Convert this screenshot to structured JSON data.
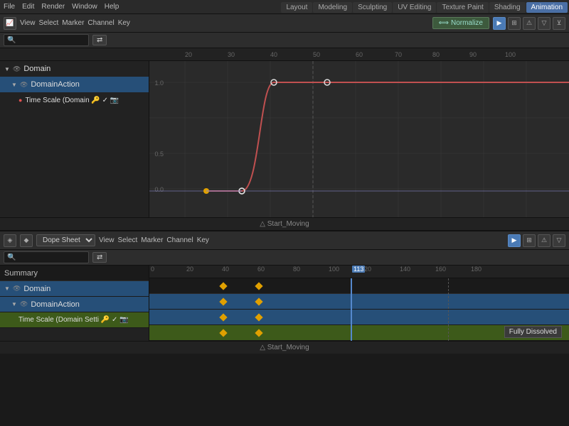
{
  "topMenu": {
    "items": [
      "File",
      "Edit",
      "Render",
      "Window",
      "Help"
    ],
    "modes": [
      "Layout",
      "Modeling",
      "Sculpting",
      "UV Editing",
      "Texture Paint",
      "Shading",
      "Animation"
    ]
  },
  "graphEditor": {
    "toolbar": {
      "viewLabel": "View",
      "selectLabel": "Select",
      "markerLabel": "Marker",
      "channelLabel": "Channel",
      "keyLabel": "Key",
      "normalizeLabel": "Normalize",
      "searchPlaceholder": "🔍"
    },
    "channels": [
      {
        "id": "domain",
        "label": "Domain",
        "indent": 0,
        "selected": false,
        "icon": "eye"
      },
      {
        "id": "domainaction",
        "label": "DomainAction",
        "indent": 1,
        "selected": true,
        "icon": "eye"
      },
      {
        "id": "timescale",
        "label": "Time Scale (Domain 🔑 ✓ 📷",
        "indent": 2,
        "selected": false,
        "icon": "red-dot"
      }
    ],
    "timeline": {
      "numbers": [
        20,
        30,
        40,
        50,
        60,
        70,
        80,
        90,
        100
      ],
      "scaleLabels": [
        "1.0",
        "0.5",
        "0.0"
      ]
    },
    "statusLabel": "△ Start_Moving"
  },
  "dopeSheet": {
    "toolbar": {
      "viewLabel": "View",
      "selectLabel": "Select",
      "markerLabel": "Marker",
      "channelLabel": "Channel",
      "keyLabel": "Key",
      "modeLabel": "Dope Sheet"
    },
    "channels": [
      {
        "id": "summary",
        "label": "Summary",
        "indent": 0,
        "type": "summary"
      },
      {
        "id": "domain",
        "label": "Domain",
        "indent": 0,
        "type": "domain",
        "selected": true
      },
      {
        "id": "domainaction",
        "label": "DomainAction",
        "indent": 1,
        "type": "action",
        "selected": true
      },
      {
        "id": "timescale",
        "label": "Time Scale (Domain Setti 🔑 ✓ 📷",
        "indent": 2,
        "type": "timescale"
      }
    ],
    "timeline": {
      "numbers": [
        0,
        20,
        40,
        60,
        80,
        100,
        120,
        140,
        160,
        180
      ],
      "currentFrame": 113,
      "keyframes": {
        "summary": [
          40,
          60
        ],
        "domain": [
          40,
          60
        ],
        "domainaction": [
          40,
          60
        ],
        "timescale": [
          40,
          60
        ]
      }
    },
    "statusLabel": "△ Start_Moving",
    "tooltip": "Fully Dissolved"
  }
}
